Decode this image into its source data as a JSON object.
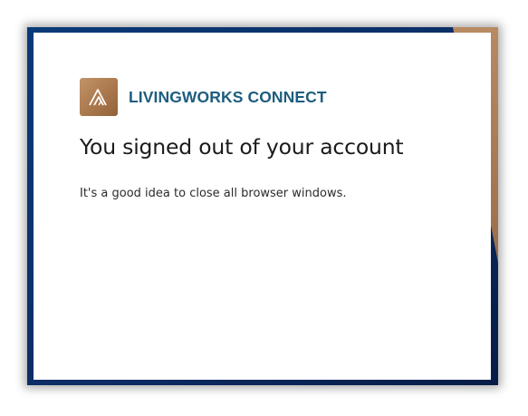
{
  "colors": {
    "brand_text": "#1d5d7e",
    "logo_bronze": "#a8754a",
    "background_navy": "#0d2f66"
  },
  "brand": {
    "logo_icon": "livingworks-mountain-logo-icon",
    "name": "LIVINGWORKS CONNECT"
  },
  "main": {
    "title": "You signed out of your account",
    "message": "It's a good idea to close all browser windows."
  }
}
